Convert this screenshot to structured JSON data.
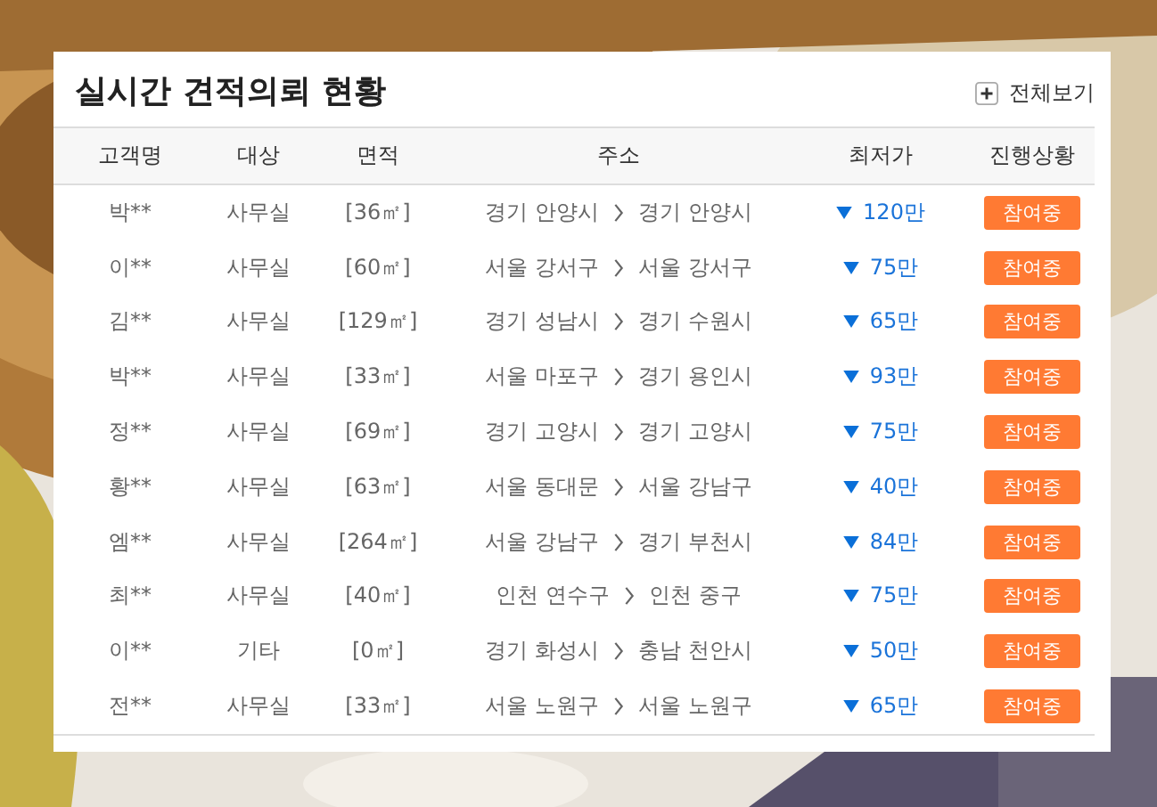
{
  "panel": {
    "title": "실시간 견적의뢰 현황",
    "view_all": "전체보기"
  },
  "table": {
    "columns": [
      "고객명",
      "대상",
      "면적",
      "주소",
      "최저가",
      "진행상황"
    ],
    "rows": [
      {
        "customer": "박**",
        "target": "사무실",
        "area": "[36㎡]",
        "from": "경기 안양시",
        "to": "경기 안양시",
        "price": "120만",
        "status": "참여중"
      },
      {
        "customer": "이**",
        "target": "사무실",
        "area": "[60㎡]",
        "from": "서울 강서구",
        "to": "서울 강서구",
        "price": "75만",
        "status": "참여중"
      },
      {
        "customer": "김**",
        "target": "사무실",
        "area": "[129㎡]",
        "from": "경기 성남시",
        "to": "경기 수원시",
        "price": "65만",
        "status": "참여중"
      },
      {
        "customer": "박**",
        "target": "사무실",
        "area": "[33㎡]",
        "from": "서울 마포구",
        "to": "경기 용인시",
        "price": "93만",
        "status": "참여중"
      },
      {
        "customer": "정**",
        "target": "사무실",
        "area": "[69㎡]",
        "from": "경기 고양시",
        "to": "경기 고양시",
        "price": "75만",
        "status": "참여중"
      },
      {
        "customer": "황**",
        "target": "사무실",
        "area": "[63㎡]",
        "from": "서울 동대문",
        "to": "서울 강남구",
        "price": "40만",
        "status": "참여중"
      },
      {
        "customer": "엠**",
        "target": "사무실",
        "area": "[264㎡]",
        "from": "서울 강남구",
        "to": "경기 부천시",
        "price": "84만",
        "status": "참여중"
      },
      {
        "customer": "최**",
        "target": "사무실",
        "area": "[40㎡]",
        "from": "인천 연수구",
        "to": "인천 중구",
        "price": "75만",
        "status": "참여중"
      },
      {
        "customer": "이**",
        "target": "기타",
        "area": "[0㎡]",
        "from": "경기 화성시",
        "to": "충남 천안시",
        "price": "50만",
        "status": "참여중"
      },
      {
        "customer": "전**",
        "target": "사무실",
        "area": "[33㎡]",
        "from": "서울 노원구",
        "to": "서울 노원구",
        "price": "65만",
        "status": "참여중"
      }
    ]
  }
}
